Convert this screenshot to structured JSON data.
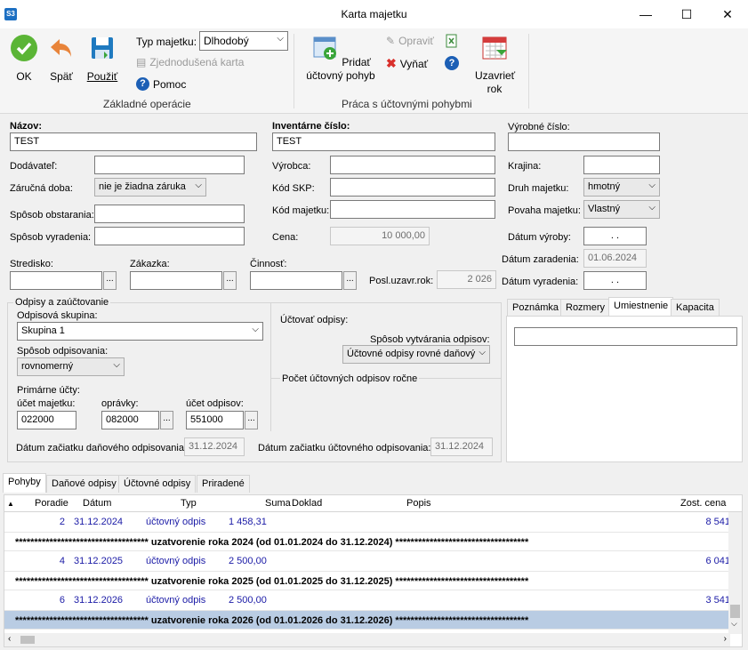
{
  "window": {
    "app_logo": "S3",
    "title": "Karta majetku",
    "minimize": "—",
    "maximize": "☐",
    "close": "✕"
  },
  "ribbon": {
    "ok": "OK",
    "back": "Späť",
    "apply": "Použiť",
    "asset_type_label": "Typ majetku:",
    "asset_type_value": "Dlhodobý",
    "simplified_card": "Zjednodušená karta",
    "help": "Pomoc",
    "group_basic": "Základné operácie",
    "add_movement": "Pridať účtovný pohyb",
    "edit": "Opraviť",
    "remove": "Vyňať",
    "close_year": "Uzavrieť rok",
    "group_movements": "Práca s účtovnými pohybmi"
  },
  "form": {
    "name_label": "Názov:",
    "name_value": "TEST",
    "inventory_label": "Inventárne číslo:",
    "inventory_value": "TEST",
    "serial_label": "Výrobné číslo:",
    "serial_value": "",
    "supplier_label": "Dodávateľ:",
    "supplier_value": "",
    "manufacturer_label": "Výrobca:",
    "manufacturer_value": "",
    "country_label": "Krajina:",
    "country_value": "",
    "warranty_label": "Záručná doba:",
    "warranty_value": "nie je žiadna záruka",
    "skp_label": "Kód SKP:",
    "skp_value": "",
    "kind_label": "Druh majetku:",
    "kind_value": "hmotný",
    "acquisition_label": "Spôsob obstarania:",
    "acquisition_value": "",
    "asset_code_label": "Kód majetku:",
    "asset_code_value": "",
    "nature_label": "Povaha majetku:",
    "nature_value": "Vlastný",
    "disposal_label": "Spôsob vyradenia:",
    "disposal_value": "",
    "price_label": "Cena:",
    "price_value": "10 000,00",
    "prod_date_label": "Dátum výroby:",
    "prod_date_value": ". .",
    "incl_date_label": "Dátum zaradenia:",
    "incl_date_value": "01.06.2024",
    "center_label": "Stredisko:",
    "order_label": "Zákazka:",
    "activity_label": "Činnosť:",
    "last_closed_label": "Posl.uzavr.rok:",
    "last_closed_value": "2 026",
    "exclusion_date_label": "Dátum vyradenia:",
    "exclusion_date_value": ". .",
    "ellipsis": "..."
  },
  "depr": {
    "title": "Odpisy a zaúčtovanie",
    "group_label": "Odpisová skupina:",
    "group_value": "Skupina 1",
    "method_label": "Spôsob odpisovania:",
    "method_value": "rovnomerný",
    "primary_label": "Primárne účty:",
    "acc_asset_label": "účet majetku:",
    "acc_asset_value": "022000",
    "acc_corr_label": "oprávky:",
    "acc_corr_value": "082000",
    "acc_depr_label": "účet odpisov:",
    "acc_depr_value": "551000",
    "post_label": "Účtovať odpisy:",
    "creation_label": "Spôsob vytvárania odpisov:",
    "creation_value": "Účtovné odpisy rovné daňový",
    "count_label": "Počet účtovných odpisov ročne",
    "tax_start_label": "Dátum začiatku daňového odpisovania:",
    "tax_start_value": "31.12.2024",
    "acc_start_label": "Dátum začiatku účtovného odpisovania:",
    "acc_start_value": "31.12.2024"
  },
  "right_tabs": [
    "Poznámka",
    "Rozmery",
    "Umiestnenie",
    "Kapacita"
  ],
  "location_value": "",
  "bottom_tabs": [
    "Pohyby",
    "Daňové odpisy",
    "Účtovné odpisy",
    "Priradené"
  ],
  "grid": {
    "headers": [
      "Poradie",
      "Dátum",
      "Typ",
      "Suma",
      "Doklad",
      "Popis",
      "Zost. cena"
    ],
    "rows": [
      {
        "kind": "data",
        "order": "2",
        "date": "31.12.2024",
        "type": "účtovný odpis",
        "amount": "1 458,31",
        "residual": "8 541"
      },
      {
        "kind": "sep",
        "text": "*********************************** uzatvorenie roka 2024 (od 01.01.2024 do 31.12.2024) ***********************************"
      },
      {
        "kind": "data",
        "order": "4",
        "date": "31.12.2025",
        "type": "účtovný odpis",
        "amount": "2 500,00",
        "residual": "6 041"
      },
      {
        "kind": "sep",
        "text": "*********************************** uzatvorenie roka 2025 (od 01.01.2025 do 31.12.2025) ***********************************"
      },
      {
        "kind": "data",
        "order": "6",
        "date": "31.12.2026",
        "type": "účtovný odpis",
        "amount": "2 500,00",
        "residual": "3 541"
      },
      {
        "kind": "sep",
        "text": "*********************************** uzatvorenie roka 2026 (od 01.01.2026 do 31.12.2026) ***********************************"
      }
    ]
  },
  "colors": {
    "ok_green": "#5bb536",
    "back_orange": "#e8843a",
    "link_blue": "#1a1aa6",
    "selection": "#b9cce3"
  }
}
